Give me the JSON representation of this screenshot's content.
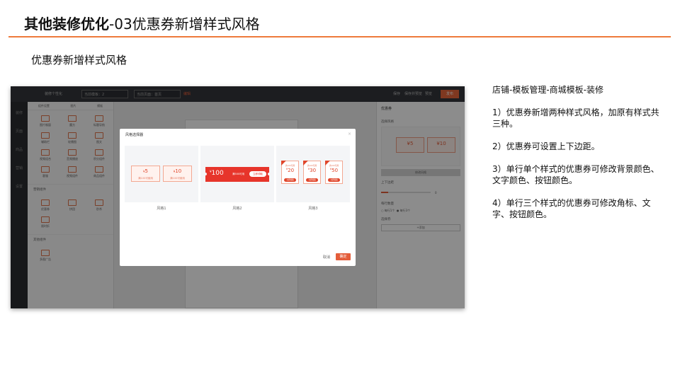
{
  "header": {
    "title_bold": "其他装修优化",
    "title_rest": "-03优惠券新增样式风格",
    "subtitle": "优惠券新增样式风格"
  },
  "screenshot": {
    "topbar": {
      "store": "装修个性化",
      "template_select": "当前模板：2",
      "page_select": "当前页面：首页",
      "tag": "编辑",
      "save": "保存",
      "preview": "保存并预览",
      "view": "预览",
      "publish": "发布"
    },
    "left_nav": [
      "装修",
      "页面",
      "商品",
      "营销",
      "设置"
    ],
    "widget_tabs": [
      "组件设置",
      "图片",
      "模板"
    ],
    "widgets": [
      "图片橱窗",
      "魔方",
      "标题导航",
      "辅助栏",
      "轮播图",
      "图文",
      "视频组合",
      "音频播放",
      "积分组件",
      "客服",
      "视频组件",
      "商品组件"
    ],
    "widget_section1": "营销组件",
    "marketing_widgets": [
      "优惠券",
      "拼团",
      "秒杀",
      "限时折"
    ],
    "widget_section2": "其他组件",
    "other_widgets": [
      "多图广告"
    ],
    "right_panel": {
      "title": "优惠券",
      "style_label": "选择风格",
      "coupon_a": "¥5",
      "coupon_b": "¥10",
      "style_button": "修改风格",
      "margin_label": "上下边距",
      "margin_value": "0",
      "count_label": "每行数量",
      "radio_a": "每行1个",
      "radio_b": "每行3个",
      "add_label": "选择券",
      "add_button": "+添加"
    }
  },
  "modal": {
    "title": "风格选择器",
    "close": "×",
    "style1": {
      "label": "风格1",
      "coupons": [
        {
          "currency": "¥",
          "amount": "5",
          "condition": "满100可使用"
        },
        {
          "currency": "¥",
          "amount": "10",
          "condition": "满100可使用"
        }
      ]
    },
    "style2": {
      "label": "风格2",
      "currency": "¥",
      "amount": "100",
      "condition": "满500可用",
      "button": "立即领取"
    },
    "style3": {
      "label": "风格3",
      "coupons": [
        {
          "tag": "满100可用",
          "currency": "¥",
          "amount": "20",
          "button": "立即领取"
        },
        {
          "tag": "满100可用",
          "currency": "¥",
          "amount": "30",
          "button": "立即领取"
        },
        {
          "tag": "满100可用",
          "currency": "¥",
          "amount": "50",
          "button": "立即领取"
        }
      ]
    },
    "cancel": "取消",
    "ok": "确定"
  },
  "notes": {
    "path": "店铺-模板管理-商城模板-装修",
    "item1": "1）优惠券新增两种样式风格，加原有样式共三种。",
    "item2": "2）优惠券可设置上下边距。",
    "item3": "3）单行单个样式的优惠券可修改背景颜色、文字颜色、按钮颜色。",
    "item4": "4）单行三个样式的优惠券可修改角标、文字、按钮颜色。"
  },
  "colors": {
    "accent_line": "#ee7a3b",
    "coupon_red": "#e7352b",
    "confirm_button": "#e45d3a"
  }
}
